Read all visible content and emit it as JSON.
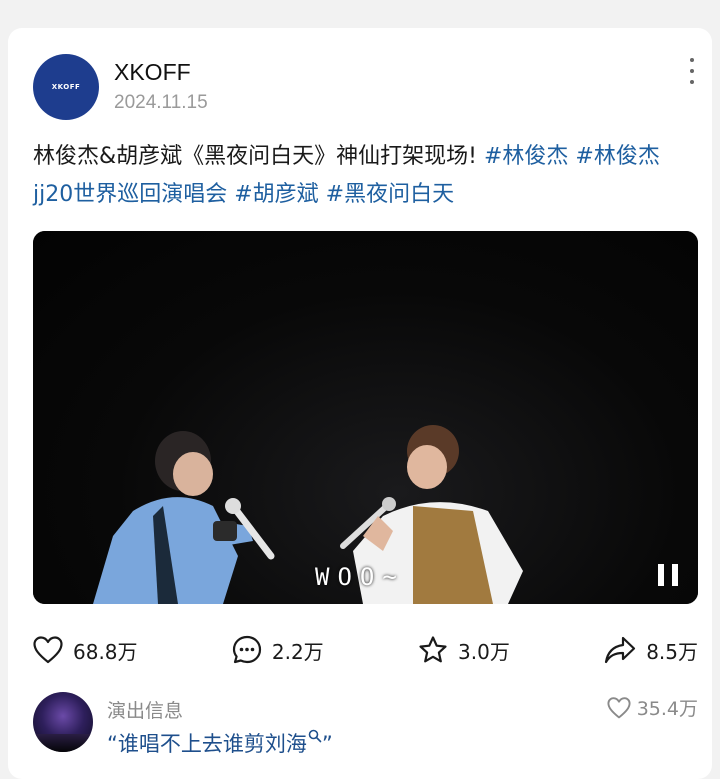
{
  "post": {
    "author": "XKOFF",
    "avatar_text": "XKOFF",
    "date": "2024.11.15",
    "text_prefix": "林俊杰&胡彦斌《黑夜问白天》神仙打架现场! ",
    "hashtags": [
      "#林俊杰",
      "#林俊杰jj20世界巡回演唱会",
      "#胡彦斌",
      "#黑夜问白天"
    ]
  },
  "video": {
    "subtitle": "WOO~",
    "state_icon": "pause-icon"
  },
  "actions": {
    "like_count": "68.8万",
    "comment_count": "2.2万",
    "favorite_count": "3.0万",
    "share_count": "8.5万"
  },
  "related": {
    "label": "演出信息",
    "quote": "“谁唱不上去谁剪刘海",
    "quote_end": "”",
    "likes": "35.4万"
  },
  "colors": {
    "hashtag": "#1e5fa0",
    "avatar_bg": "#1e3d8e"
  }
}
